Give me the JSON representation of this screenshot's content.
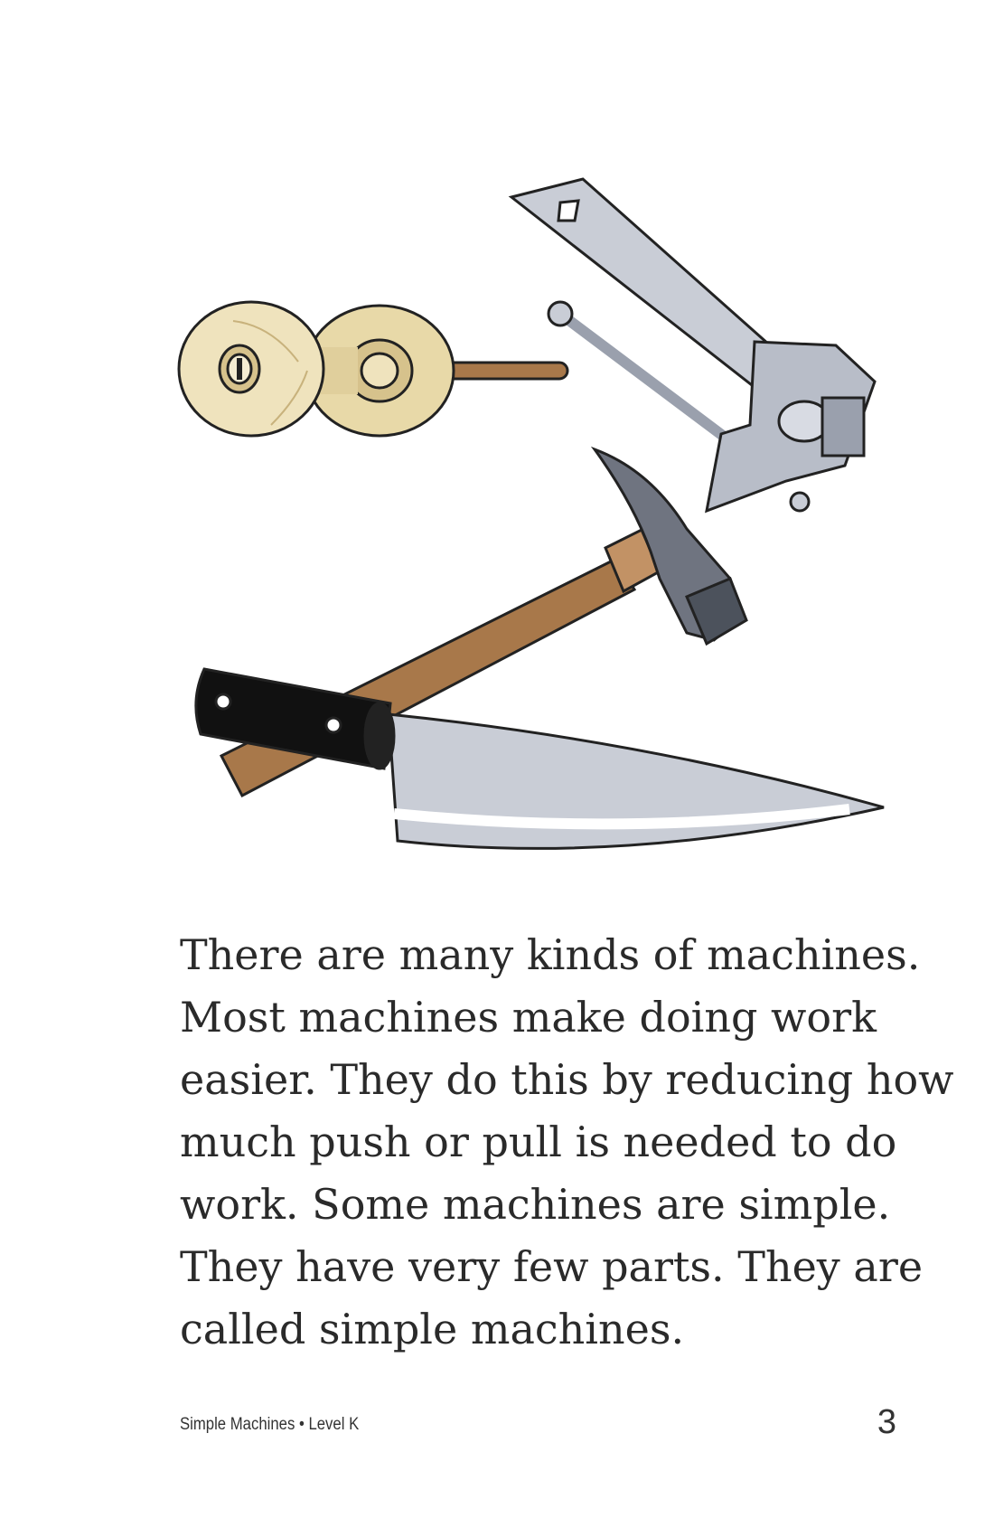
{
  "illustration": {
    "items": [
      "doorknob",
      "can-opener",
      "hammer",
      "knife"
    ]
  },
  "body_text": {
    "lines": [
      "There are many kinds of machines.",
      "Most machines make doing work",
      "easier. They do this by reducing how",
      "much push or pull is needed to do",
      "work. Some machines are simple.",
      "They have very few parts. They are",
      "called simple machines."
    ]
  },
  "footer": {
    "book_title": "Simple Machines • Level K",
    "page_number": "3"
  },
  "colors": {
    "text": "#2a2a2a",
    "knob": "#e8d9a8",
    "steel": "#c9cdd6",
    "wood": "#a8784a",
    "handle": "#111111"
  }
}
